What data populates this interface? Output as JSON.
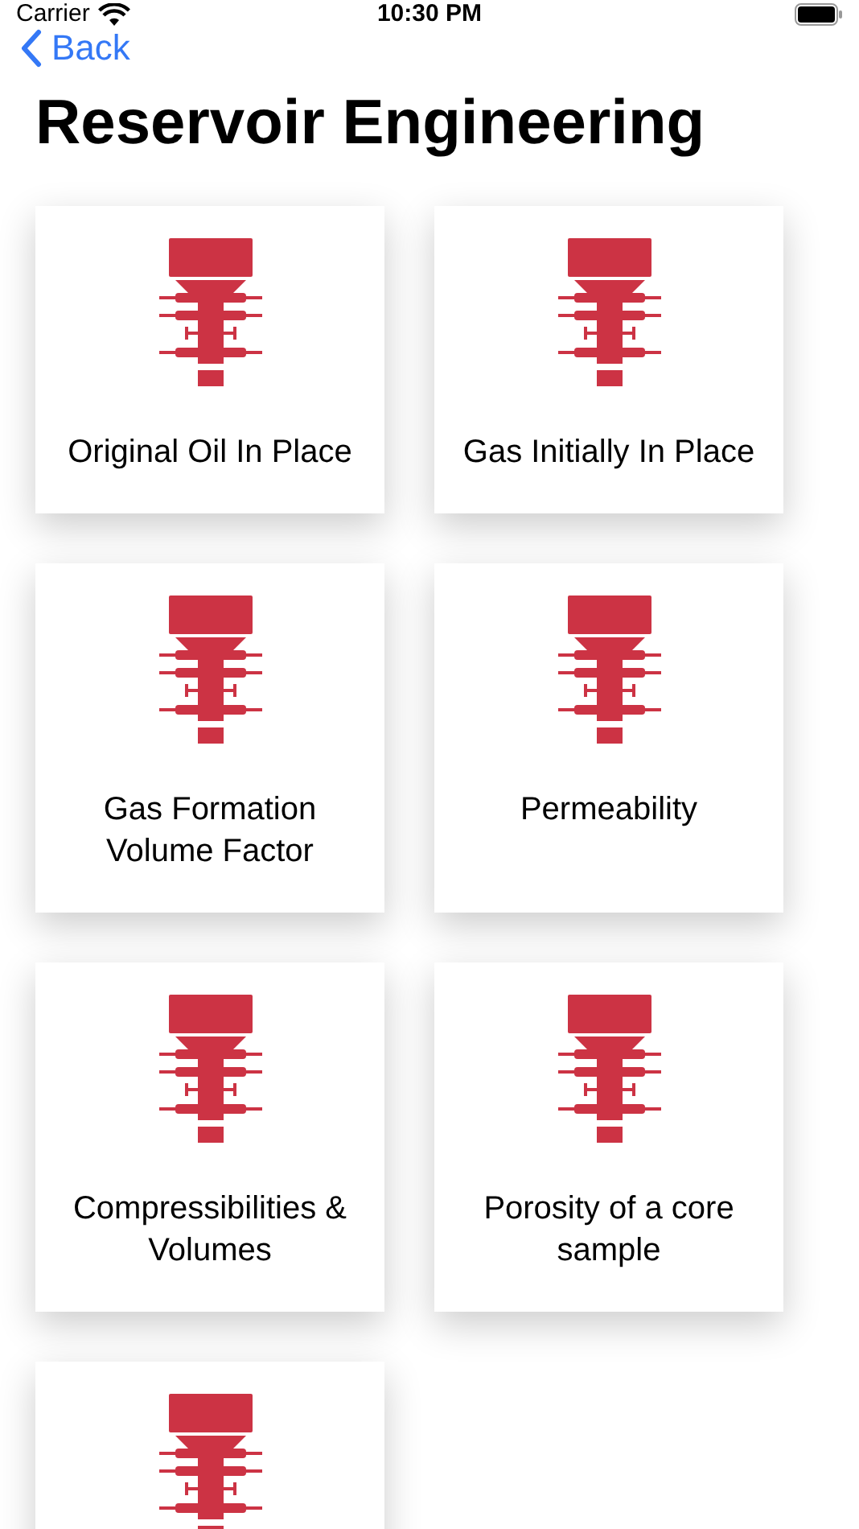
{
  "status_bar": {
    "carrier": "Carrier",
    "time": "10:30 PM"
  },
  "nav": {
    "back": "Back",
    "title": "Reservoir Engineering"
  },
  "items": [
    {
      "kind": "topic",
      "label": "Original Oil In Place"
    },
    {
      "kind": "topic",
      "label": "Gas Initially In Place"
    },
    {
      "kind": "topic",
      "label": "Gas Formation Volume Factor"
    },
    {
      "kind": "topic",
      "label": "Permeability"
    },
    {
      "kind": "topic",
      "label": "Compressibilities & Volumes"
    },
    {
      "kind": "topic",
      "label": "Porosity of a core sample"
    },
    {
      "kind": "icon_only"
    }
  ]
}
